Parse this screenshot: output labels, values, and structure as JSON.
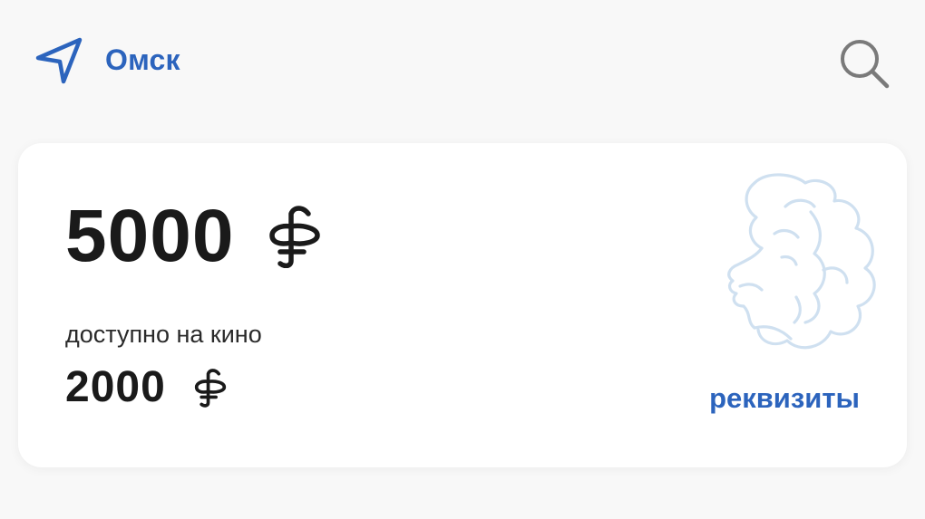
{
  "header": {
    "city": "Омск"
  },
  "card": {
    "balance": "5000",
    "available_label": "доступно на кино",
    "cinema_balance": "2000",
    "details_link": "реквизиты"
  },
  "icons": {
    "location": "location-arrow-icon",
    "search": "search-icon",
    "currency": "ruble-currency-icon",
    "portrait": "pushkin-portrait-icon"
  },
  "colors": {
    "accent": "#2c64bd",
    "text": "#1a1a1a",
    "background": "#f8f8f8",
    "card": "#ffffff",
    "portrait": "#cfe0f0"
  }
}
